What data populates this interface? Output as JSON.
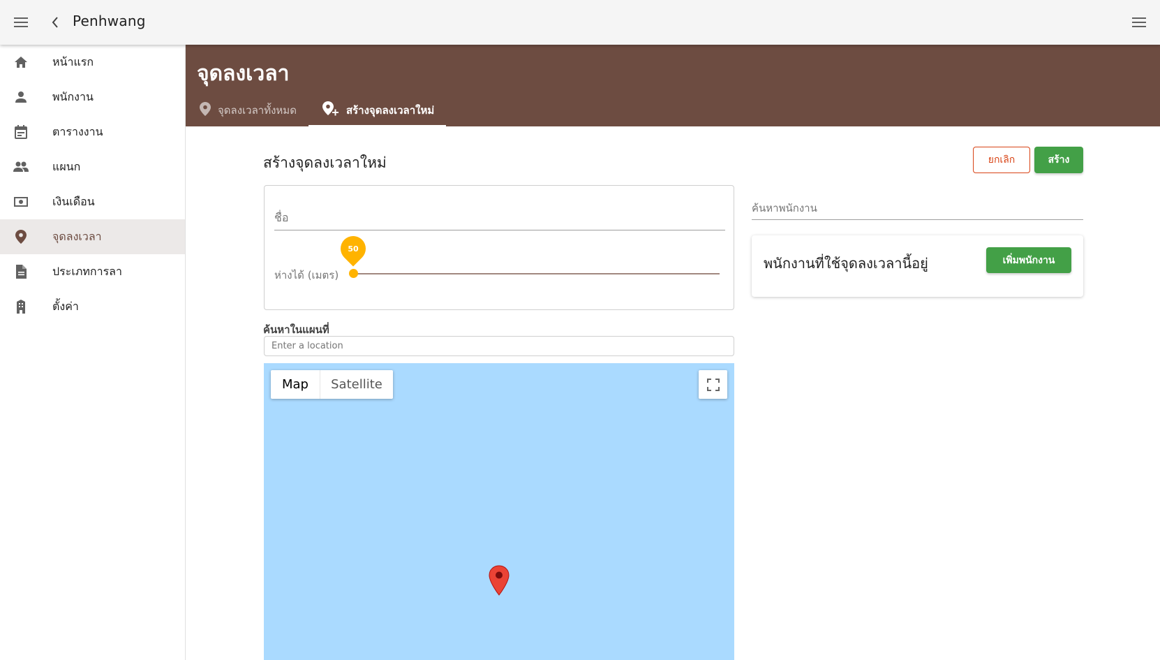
{
  "appbar": {
    "title": "Penhwang",
    "menu_icon": "menu-icon",
    "back_icon": "chevron-left-icon",
    "right_menu_icon": "menu-icon"
  },
  "sidebar": {
    "items": [
      {
        "label": "หน้าแรก",
        "icon": "home-icon"
      },
      {
        "label": "พนักงาน",
        "icon": "person-icon"
      },
      {
        "label": "ตารางงาน",
        "icon": "calendar-icon"
      },
      {
        "label": "แผนก",
        "icon": "people-icon"
      },
      {
        "label": "เงินเดือน",
        "icon": "money-icon"
      },
      {
        "label": "จุดลงเวลา",
        "icon": "location-pin-icon",
        "active": true
      },
      {
        "label": "ประเภทการลา",
        "icon": "document-icon"
      },
      {
        "label": "ตั้งค่า",
        "icon": "building-icon"
      }
    ]
  },
  "header": {
    "title": "จุดลงเวลา",
    "tabs": [
      {
        "label": "จุดลงเวลาทั้งหมด",
        "icon": "location-pin-icon"
      },
      {
        "label": "สร้างจุดลงเวลาใหม่",
        "icon": "add-location-icon",
        "active": true
      }
    ]
  },
  "form": {
    "section_title": "สร้างจุดลงเวลาใหม่",
    "cancel_label": "ยกเลิก",
    "create_label": "สร้าง",
    "name_placeholder": "ชื่อ",
    "distance_label": "ห่างได้ (เมตร)",
    "distance_value": "50",
    "map_search_label": "ค้นหาในแผนที่",
    "map_search_placeholder": "Enter a location"
  },
  "map": {
    "type_map": "Map",
    "type_satellite": "Satellite",
    "selected_type": "Map",
    "water_color": "#aadaff"
  },
  "employees": {
    "search_placeholder": "ค้นหาพนักงาน",
    "card_title": "พนักงานที่ใช้จุดลงเวลานี้อยู่",
    "add_label": "เพิ่มพนักงาน"
  },
  "colors": {
    "primary": "#6d4c41",
    "accent": "#ffb300",
    "success": "#43a047",
    "danger": "#d84315"
  }
}
